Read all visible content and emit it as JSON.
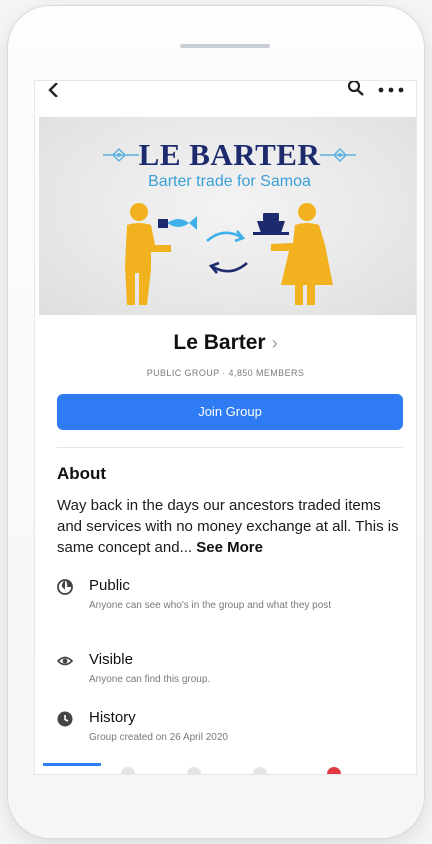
{
  "cover": {
    "title": "LE BARTER",
    "subtitle": "Barter trade for Samoa"
  },
  "group": {
    "name": "Le Barter",
    "chevron": "›",
    "meta": "PUBLIC GROUP · 4,850 MEMBERS",
    "join_label": "Join Group"
  },
  "about": {
    "title": "About",
    "text": "Way back in the days our ancestors traded items and services with no money exchange at all. This is same concept and...",
    "see_more": "See More",
    "items": [
      {
        "icon": "globe-icon",
        "title": "Public",
        "desc": "Anyone can see who's in the group and what they post"
      },
      {
        "icon": "eye-icon",
        "title": "Visible",
        "desc": "Anyone can find this group."
      },
      {
        "icon": "clock-icon",
        "title": "History",
        "desc": "Group created on 26 April 2020"
      }
    ]
  },
  "colors": {
    "primary": "#2f7bf3",
    "title_navy": "#1d2a6e",
    "accent_blue": "#3aa0d8",
    "figure_yellow": "#f2b21f",
    "notification_red": "#e23a45"
  }
}
